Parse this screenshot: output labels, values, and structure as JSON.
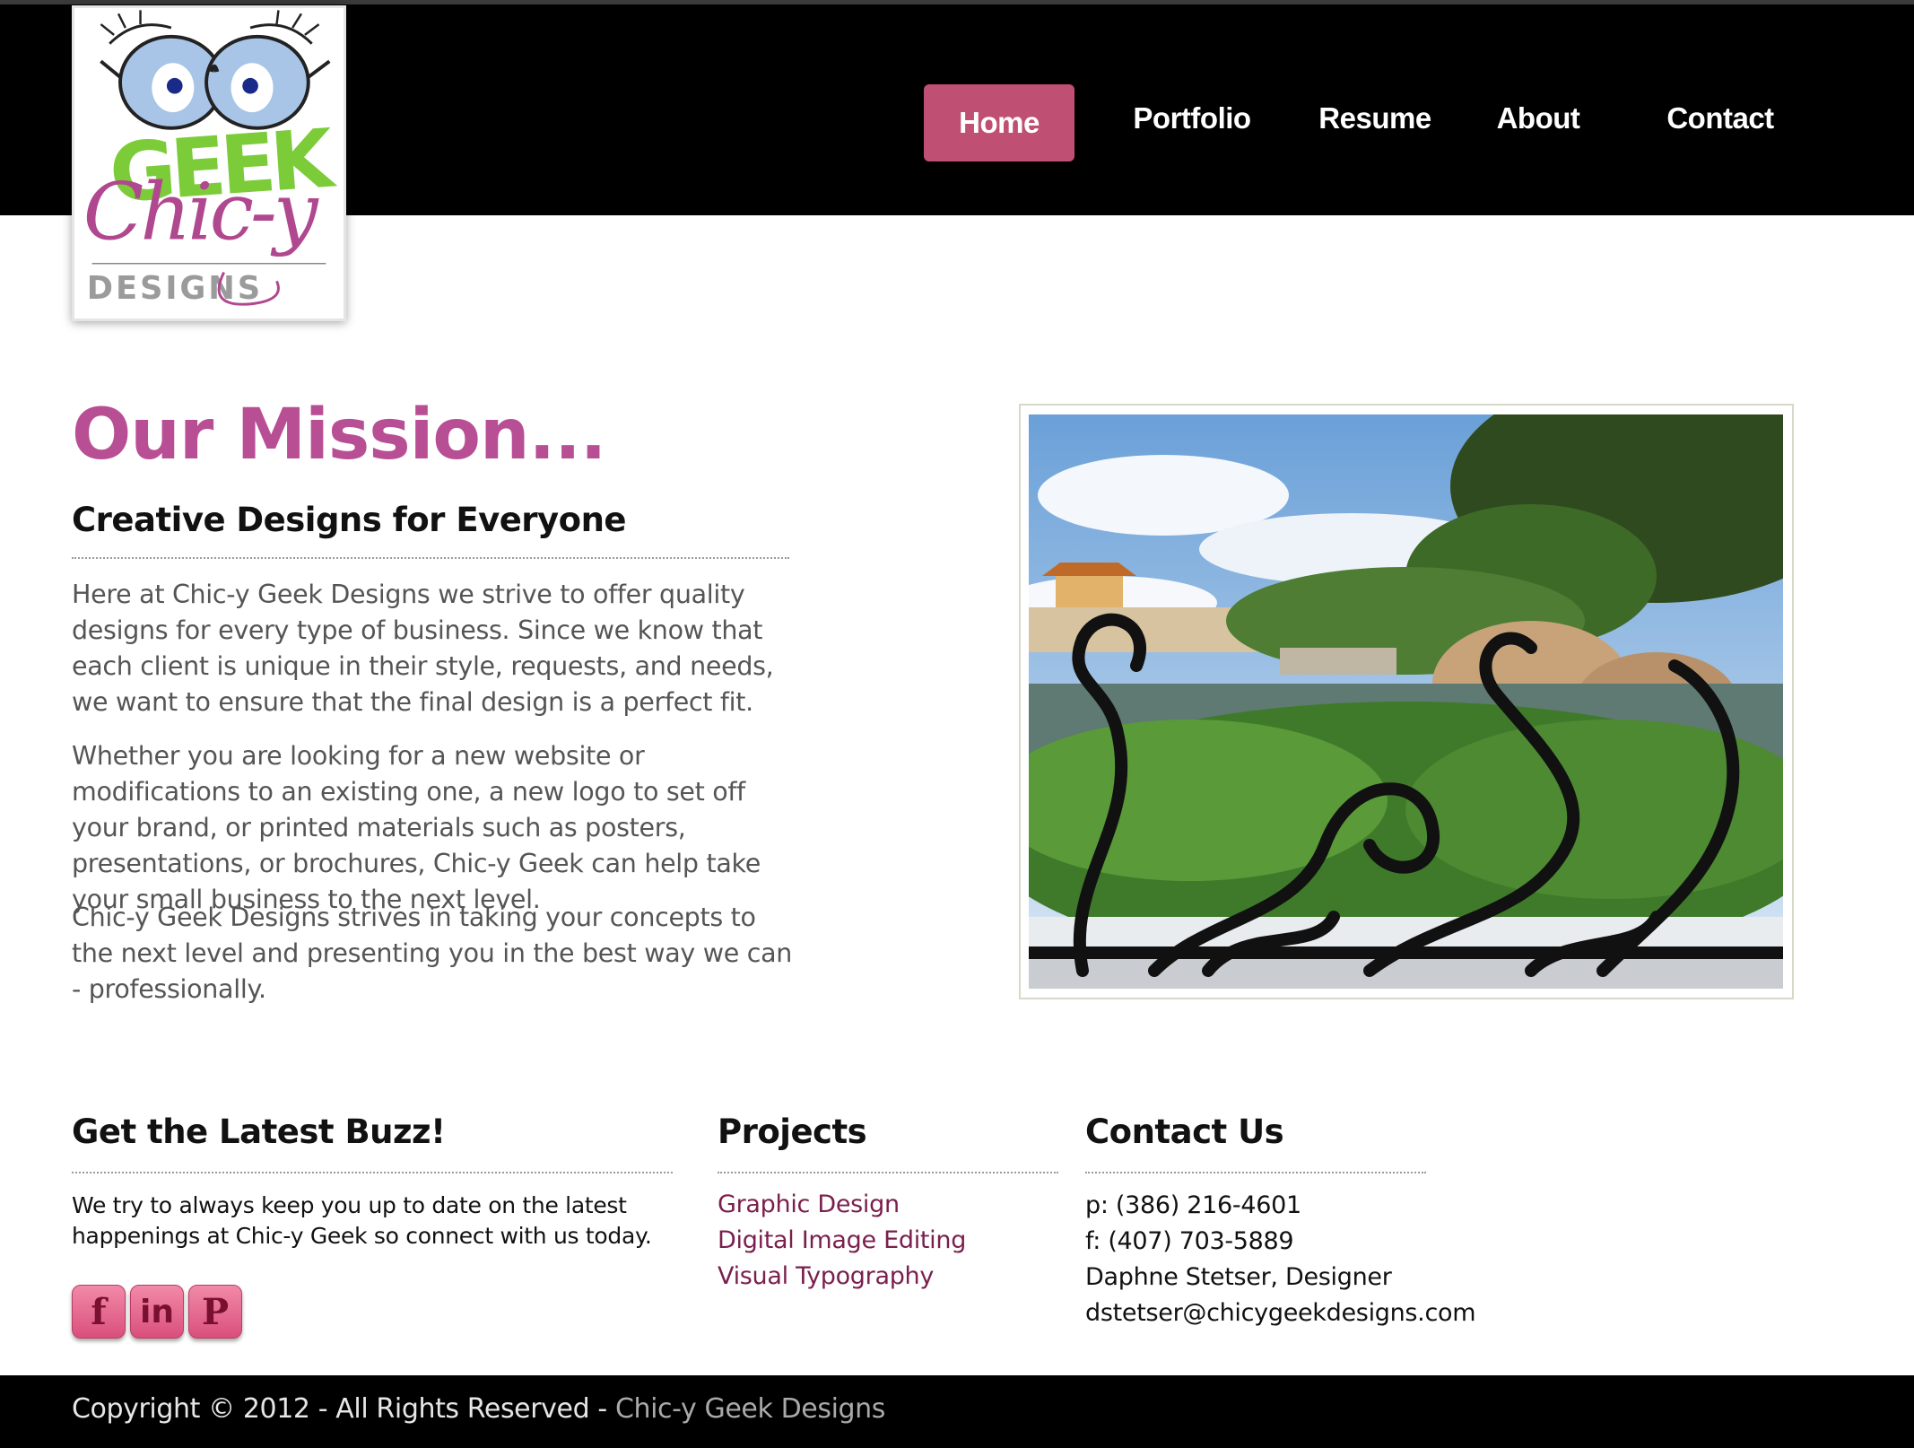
{
  "logo": {
    "top_word": "GEEK",
    "script_word": "Chic-y",
    "bottom_word": "DESIGNS"
  },
  "nav": {
    "items": [
      {
        "label": "Home",
        "active": true
      },
      {
        "label": "Portfolio",
        "active": false
      },
      {
        "label": "Resume",
        "active": false
      },
      {
        "label": "About",
        "active": false
      },
      {
        "label": "Contact",
        "active": false
      }
    ]
  },
  "mission": {
    "title": "Our Mission...",
    "subtitle": "Creative Designs for Everyone",
    "paragraphs": [
      "Here at Chic-y Geek Designs we strive to offer quality designs for every type of business. Since we know that each client is unique in their style, requests, and needs, we want to ensure that the final design is a perfect fit.",
      "Whether you are looking for a new website or modifications to an existing one, a new logo to set off your brand, or printed materials such as posters, presentations, or brochures, Chic-y Geek can help take your small business to the next level.",
      "Chic-y Geek Designs strives in taking your concepts to the next level and presenting you in the best way we can - professionally."
    ]
  },
  "buzz": {
    "heading": "Get the Latest Buzz!",
    "lines": [
      "We try to always keep you up to date on the latest",
      "happenings at Chic-y Geek so connect with us today."
    ],
    "social": [
      {
        "icon": "facebook-icon",
        "glyph": "f"
      },
      {
        "icon": "linkedin-icon",
        "glyph": "in"
      },
      {
        "icon": "pinterest-icon",
        "glyph": "P"
      }
    ]
  },
  "projects": {
    "heading": "Projects",
    "links": [
      "Graphic Design",
      "Digital Image Editing",
      "Visual Typography"
    ]
  },
  "contact": {
    "heading": "Contact Us",
    "phone": "p: (386) 216-4601",
    "fax": "f: (407) 703-5889",
    "name": "Daphne Stetser, Designer",
    "email": "dstetser@chicygeekdesigns.com"
  },
  "footer": {
    "copyright": "Copyright © 2012 - All Rights Reserved - ",
    "brand": "Chic-y Geek Designs"
  },
  "colors": {
    "accent": "#c04f74",
    "title": "#b84f94",
    "link": "#7a1f4e",
    "header_bg": "#000000"
  }
}
